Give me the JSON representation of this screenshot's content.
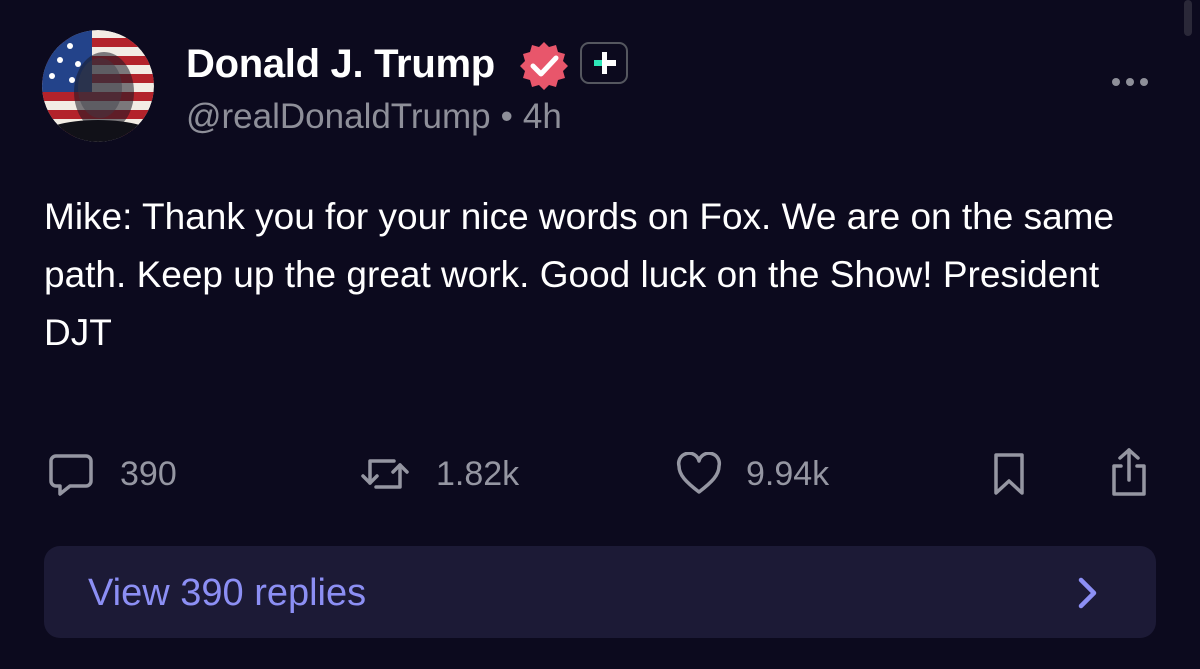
{
  "author": {
    "display_name": "Donald J. Trump",
    "handle": "@realDonaldTrump",
    "separator": "•",
    "time_ago": "4h"
  },
  "post": {
    "text": "Mike: Thank you for your nice words on Fox. We are on the same path. Keep up the great work. Good luck on the Show! President DJT"
  },
  "actions": {
    "replies_count": "390",
    "reposts_count": "1.82k",
    "likes_count": "9.94k"
  },
  "view_replies": {
    "label": "View 390 replies"
  },
  "icons": {
    "verified": "verified-check-icon",
    "plus": "plus-badge-icon",
    "more": "more-horizontal-icon",
    "reply": "comment-icon",
    "repost": "repost-icon",
    "like": "heart-icon",
    "bookmark": "bookmark-icon",
    "share": "share-icon",
    "chevron": "chevron-right-icon"
  },
  "colors": {
    "background": "#0c0a1e",
    "verified_badge": "#e8566b",
    "plus_accent": "#2ee6b8",
    "link": "#8c8ff4",
    "muted_text": "#8e8f99",
    "reply_bar": "#1c1a36"
  }
}
